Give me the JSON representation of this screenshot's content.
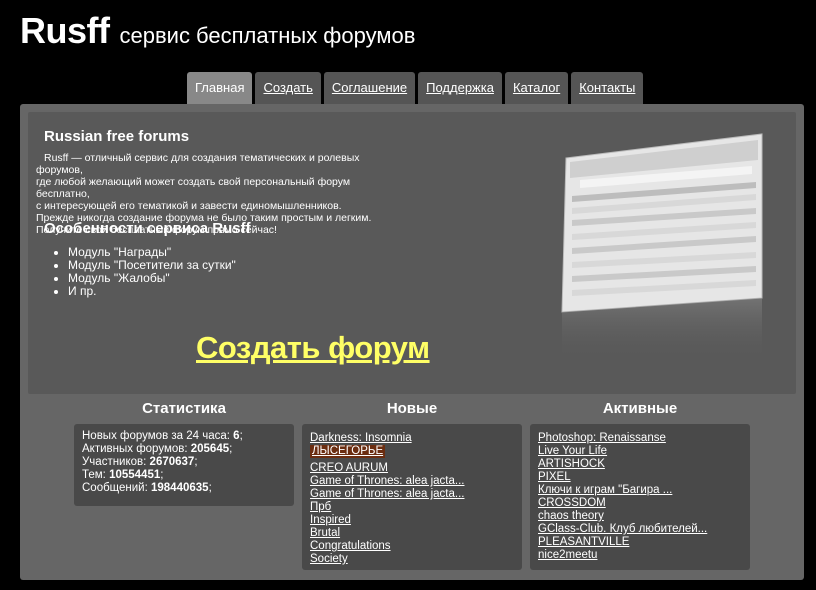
{
  "header": {
    "logo": "Rusff",
    "tagline": "сервис бесплатных форумов"
  },
  "tabs": [
    {
      "label": "Главная",
      "active": true
    },
    {
      "label": "Создать"
    },
    {
      "label": "Соглашение"
    },
    {
      "label": "Поддержка"
    },
    {
      "label": "Каталог"
    },
    {
      "label": "Контакты"
    }
  ],
  "hero": {
    "title": "Russian free forums",
    "text": [
      "Rusff — отличный сервис для создания тематических и ролевых форумов,",
      "где любой желающий может создать свой персональный форум бесплатно,",
      "с интересующей его тематикой и завести единомышленников.",
      "Прежде никогда создание форума не было таким простым и легким.",
      "Получите свой бесплатный форум прямо сейчас!"
    ],
    "features_title": "Особенности сервиса Rusff",
    "features": [
      "Модуль \"Награды\"",
      "Модуль \"Посетители за сутки\"",
      "Модуль \"Жалобы\"",
      "И пр."
    ],
    "create_link": "Создать форум"
  },
  "stats": {
    "title": "Статистика",
    "rows": [
      {
        "label": "Новых форумов за 24 часа: ",
        "value": "6",
        "suffix": ";"
      },
      {
        "label": "Активных форумов: ",
        "value": "205645",
        "suffix": ";"
      },
      {
        "label": "Участников: ",
        "value": "2670637",
        "suffix": ";"
      },
      {
        "label": "Тем: ",
        "value": "10554451",
        "suffix": ";"
      },
      {
        "label": "Сообщений: ",
        "value": "198440635",
        "suffix": ";"
      }
    ]
  },
  "new_forums": {
    "title": "Новые",
    "items": [
      "Darkness: Insomnia",
      "ЛЫСЕГОРЬЕ",
      "CREO AURUM",
      "Game of Thrones: alea jacta...",
      "Game of Thrones: alea jacta...",
      "Прб",
      "Inspired",
      "Brutal",
      "Congratulations",
      "Society"
    ],
    "highlight_index": 1
  },
  "active_forums": {
    "title": "Активные",
    "items": [
      "Photoshop: Renaissanse",
      "Live Your Life",
      "ARTISHOCK",
      "PIXEL",
      "Ключи к играм \"Багира ...",
      "CROSSDOM",
      "chaos theory",
      "GClass-Club. Клуб любителей...",
      "PLEASANTVILLE",
      "nice2meetu"
    ]
  },
  "colors": {
    "link_yellow": "#ffff66",
    "highlight": "#6b2d10",
    "panel": "#666666"
  }
}
